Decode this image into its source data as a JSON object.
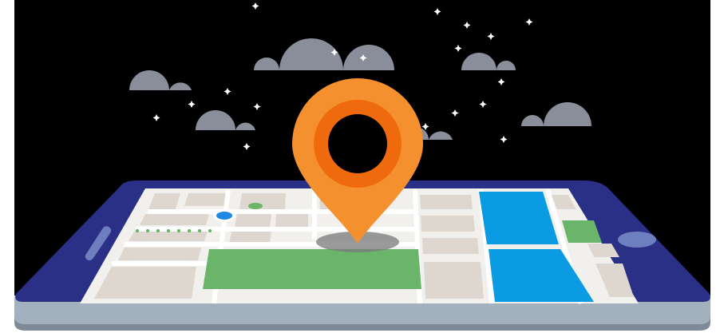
{
  "illustration": {
    "colors": {
      "sky": "#000000",
      "cloud": "#8a8d9a",
      "star": "#ffffff",
      "phone_body": "#2b3087",
      "phone_base": "#a3b0be",
      "phone_base_shadow": "#7f8a99",
      "phone_button": "#6e7fc0",
      "map_background": "#f2f0ed",
      "map_block": "#ddd7cf",
      "map_road": "#ffffff",
      "park": "#6ab56a",
      "water": "#0a9be3",
      "pin_outer": "#f5902f",
      "pin_ring": "#ee6a0c",
      "pin_hole": "#000000",
      "pin_shadow": "#7a7a7a",
      "location_dot": "#1e88e5",
      "route_dots": "#5cb85c"
    },
    "icons": [
      "map-pin-icon",
      "cloud-icon",
      "star-icon",
      "smartphone-icon",
      "location-dot-icon"
    ]
  }
}
